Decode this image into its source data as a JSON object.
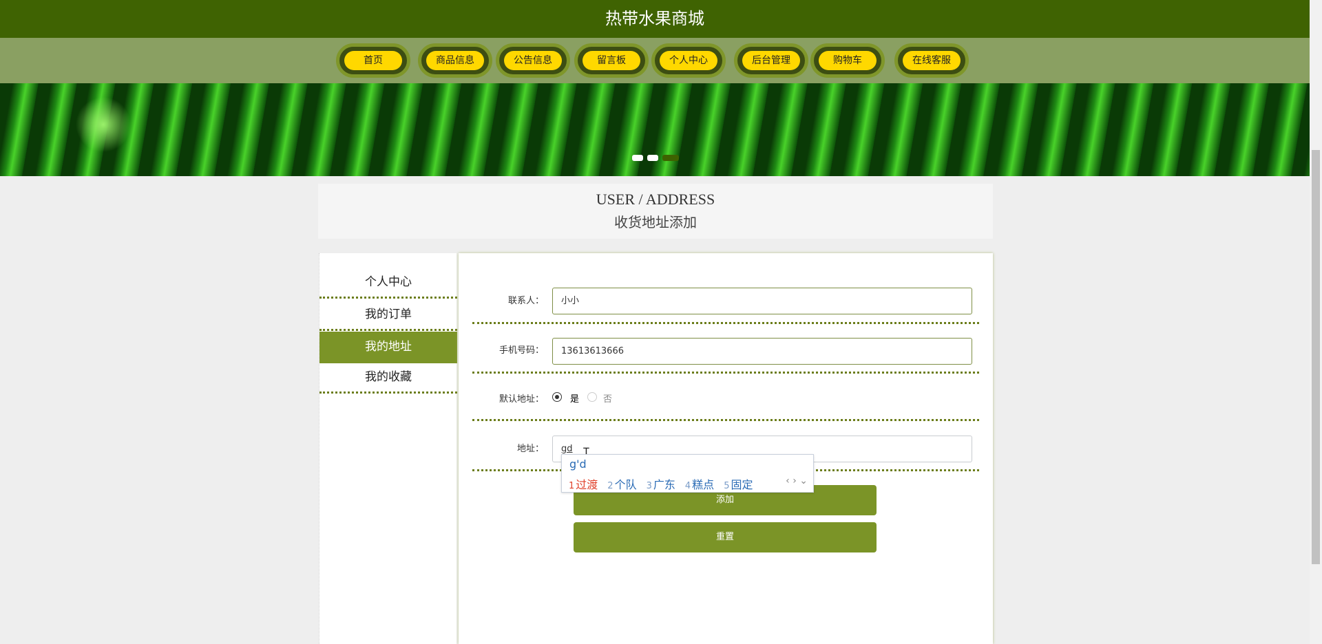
{
  "header": {
    "title": "热带水果商城"
  },
  "nav": [
    "首页",
    "商品信息",
    "公告信息",
    "留言板",
    "个人中心",
    "后台管理",
    "购物车",
    "在线客服"
  ],
  "page_title": {
    "en": "USER / ADDRESS",
    "cn": "收货地址添加"
  },
  "sidebar": [
    "个人中心",
    "我的订单",
    "我的地址",
    "我的收藏"
  ],
  "form": {
    "contact_label": "联系人：",
    "contact_value": "小小",
    "phone_label": "手机号码：",
    "phone_value": "13613613666",
    "default_label": "默认地址：",
    "yes": "是",
    "no": "否",
    "address_label": "地址：",
    "address_value": "gd",
    "add_button": "添加",
    "reset_button": "重置"
  },
  "ime": {
    "composition": "g'd",
    "candidates": [
      {
        "n": "1",
        "t": "过渡"
      },
      {
        "n": "2",
        "t": "个队"
      },
      {
        "n": "3",
        "t": "广东"
      },
      {
        "n": "4",
        "t": "糕点"
      },
      {
        "n": "5",
        "t": "固定"
      }
    ],
    "arrows": "‹ › ⌄"
  },
  "colors": {
    "header": "#3f6302",
    "nav": "#8aa062",
    "accent": "#7b9427",
    "pill": "#ffd800"
  }
}
